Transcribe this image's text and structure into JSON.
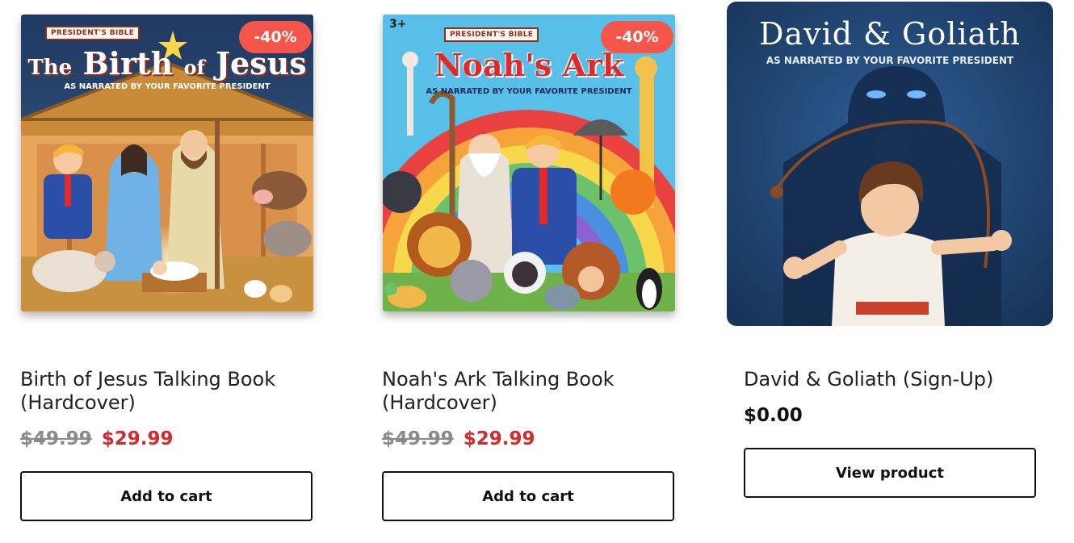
{
  "products": [
    {
      "name": "Birth of Jesus Talking Book (Hardcover)",
      "badge": "-40%",
      "price_old": "$49.99",
      "price_new": "$29.99",
      "button_label": "Add to cart",
      "cover": {
        "tag": "PRESIDENT'S BIBLE",
        "title_1": "The",
        "title_2": "Birth",
        "title_3": "of",
        "title_4": "Jesus",
        "subtitle": "AS NARRATED BY YOUR FAVORITE PRESIDENT"
      }
    },
    {
      "name": "Noah's Ark Talking Book (Hardcover)",
      "badge": "-40%",
      "price_old": "$49.99",
      "price_new": "$29.99",
      "button_label": "Add to cart",
      "cover": {
        "age": "3+",
        "tag": "PRESIDENT'S BIBLE",
        "title": "Noah's Ark",
        "subtitle": "AS NARRATED BY YOUR FAVORITE PRESIDENT"
      }
    },
    {
      "name": "David & Goliath (Sign-Up)",
      "price": "$0.00",
      "button_label": "View product",
      "cover": {
        "title": "David & Goliath",
        "subtitle": "AS NARRATED BY YOUR FAVORITE PRESIDENT"
      }
    }
  ],
  "colors": {
    "sale_price": "#d42a2a",
    "old_price": "#8a8a8a",
    "badge": "#f4574a",
    "button_border": "#111111"
  }
}
